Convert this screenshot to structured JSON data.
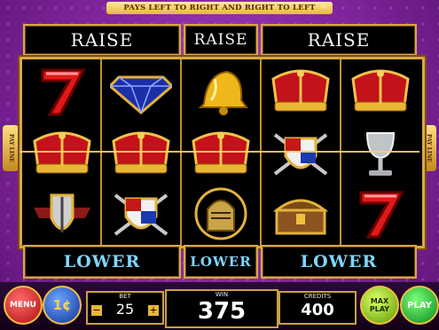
{
  "banner": {
    "text": "PAYS LEFT TO RIGHT AND RIGHT TO LEFT"
  },
  "raise": {
    "label": "RAISE"
  },
  "lower": {
    "label": "LOWER"
  },
  "side_tab": {
    "text": "PAY LINE"
  },
  "reels": [
    [
      "red-seven",
      "crown",
      "knight-shield"
    ],
    [
      "blue-diamond",
      "crown",
      "crest-shield"
    ],
    [
      "golden-bell",
      "crown",
      "knight-helmet"
    ],
    [
      "crown",
      "crest-shield",
      "treasure-chest"
    ],
    [
      "crown",
      "silver-goblet",
      "red-seven"
    ]
  ],
  "bet": {
    "label": "BET",
    "value": "25"
  },
  "win": {
    "label": "WIN",
    "value": "375"
  },
  "credits": {
    "label": "CREDITS",
    "value": "400"
  },
  "buttons": {
    "menu": "MENU",
    "denom": "1¢",
    "max_play_1": "MAX",
    "max_play_2": "PLAY",
    "play": "PLAY"
  },
  "colors": {
    "accent_gold": "#d8a844",
    "frame_purple": "#8a2aa6",
    "lower_text": "#7fd6ff"
  }
}
